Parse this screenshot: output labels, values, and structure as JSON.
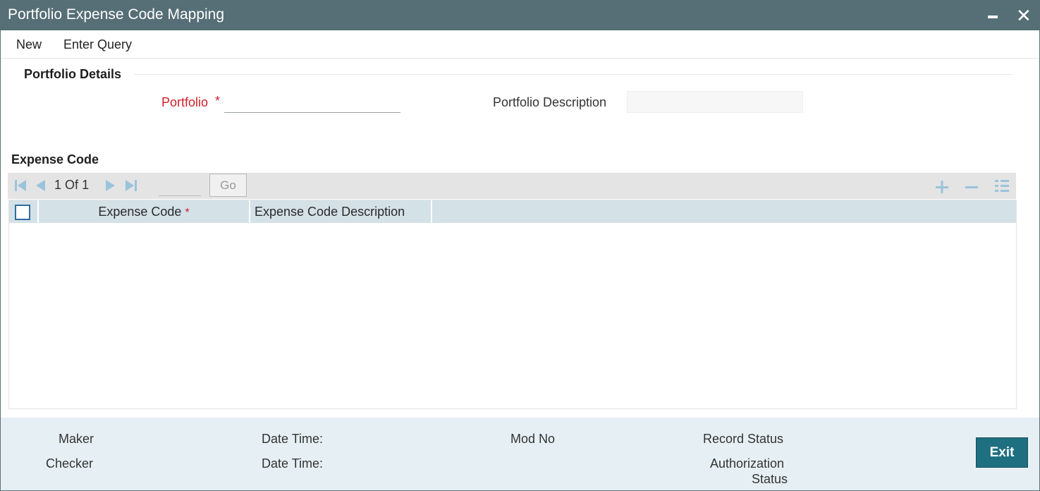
{
  "window": {
    "title": "Portfolio Expense Code Mapping",
    "minimize_icon": "minimize-icon",
    "close_icon": "close-icon",
    "close_glyph": "✕"
  },
  "menu": {
    "items": [
      "New",
      "Enter Query"
    ]
  },
  "portfolio_details": {
    "section_title": "Portfolio Details",
    "portfolio_label": "Portfolio",
    "required_marker": "*",
    "portfolio_value": "",
    "description_label": "Portfolio Description",
    "description_value": ""
  },
  "expense_code": {
    "section_title": "Expense Code",
    "pagination": {
      "current": "1",
      "of_label": "Of",
      "total": "1",
      "page_input": "",
      "go_label": "Go"
    },
    "toolbar_icons": [
      "add-row-icon",
      "delete-row-icon",
      "column-list-icon"
    ],
    "columns": [
      {
        "label": "Expense Code",
        "required_marker": "*"
      },
      {
        "label": "Expense Code Description"
      }
    ],
    "rows": []
  },
  "footer": {
    "maker_label": "Maker",
    "checker_label": "Checker",
    "maker_datetime_label": "Date Time:",
    "checker_datetime_label": "Date Time:",
    "mod_no_label": "Mod No",
    "record_status_label": "Record Status",
    "authorization_status_label_line1": "Authorization",
    "authorization_status_label_line2": "Status",
    "exit_label": "Exit"
  },
  "colors": {
    "titlebar": "#566e75",
    "accent": "#1e6f80",
    "required": "#d0202a",
    "grid_header": "#d4e1e7",
    "footer": "#e6f0f4"
  }
}
